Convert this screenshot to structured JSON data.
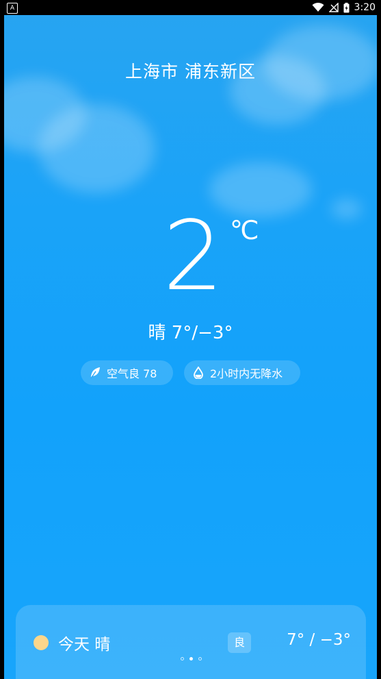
{
  "status_bar": {
    "notification_icon_label": "A",
    "time": "3:20"
  },
  "weather": {
    "location": "上海市 浦东新区",
    "temperature": "2",
    "unit": "℃",
    "condition_line": "晴  7°/−3°",
    "air_quality": "空气良 78",
    "precipitation": "2小时内无降水"
  },
  "forecast_card": {
    "day_label": "今天 晴",
    "aqi_badge": "良",
    "temp_range": "7° / −3°",
    "page_count": 3,
    "active_page": 2
  },
  "colors": {
    "sky_top": "#27a4f1",
    "sky_bottom": "#18a5fb",
    "sun": "#fbd68c",
    "text": "#ffffff"
  }
}
